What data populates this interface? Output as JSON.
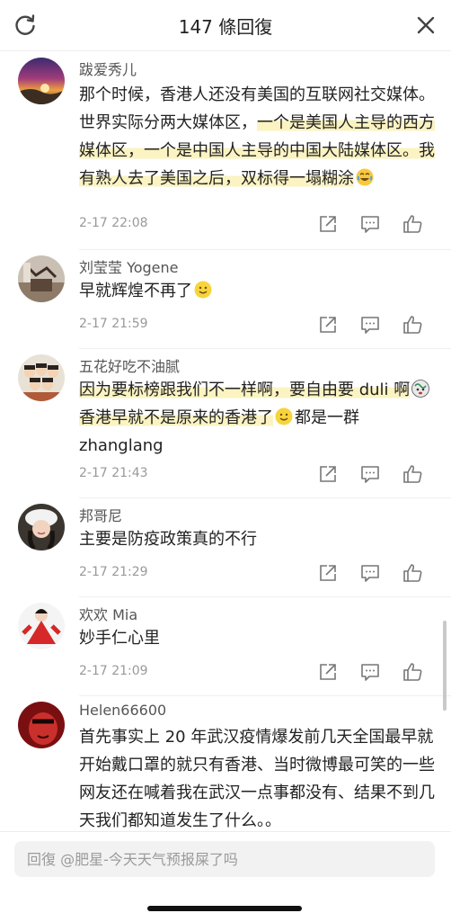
{
  "header": {
    "title": "147 條回復",
    "refresh_icon": "refresh-icon",
    "close_icon": "close-icon"
  },
  "comments": [
    {
      "username": "跋爱秀儿",
      "text_plain": "那个时候，香港人还没有美国的互联网社交媒体。世界实际分两大媒体区，",
      "text_highlight": "一个是美国人主导的西方媒体区，一个是中国人主导的中国大陆媒体区。我有熟人去了美国之后，双标得一塌糊涂",
      "emoji": "laughing-tears-emoji",
      "time": "2-17 22:08",
      "avatar": "sunset-avatar"
    },
    {
      "username": "刘莹莹 Yogene",
      "text": "早就辉煌不再了",
      "emoji": "smiley-emoji",
      "time": "2-17 21:59",
      "avatar": "room-avatar"
    },
    {
      "username": "五花好吃不油腻",
      "text_part1": "因为要标榜跟我们不一样啊，要自由要 duli 啊",
      "text_part2": "香港早就不是原来的香港了",
      "text_part3": "都是一群 zhanglang",
      "emoji1": "dizzy-face-emoji",
      "emoji2": "smiley-emoji",
      "time": "2-17 21:43",
      "avatar": "group-cartoon-avatar"
    },
    {
      "username": "邦哥尼",
      "text": "主要是防疫政策真的不行",
      "time": "2-17 21:29",
      "avatar": "woman-hat-avatar"
    },
    {
      "username": "欢欢 Mia",
      "text": "妙手仁心里",
      "time": "2-17 21:09",
      "avatar": "red-dress-avatar"
    },
    {
      "username": "Helen66600",
      "text": "首先事实上 20 年武汉疫情爆发前几天全国最早就开始戴口罩的就只有香港、当时微博最可笑的一些网友还在喊着我在武汉一点事都没有、结果不到几天我们都知道发生了什么。。",
      "avatar": "red-face-avatar"
    }
  ],
  "actions": {
    "share_icon": "share-icon",
    "comment_icon": "comment-icon",
    "like_icon": "like-icon"
  },
  "reply": {
    "placeholder": "回復 @肥星-今天天气预报屎了吗"
  }
}
